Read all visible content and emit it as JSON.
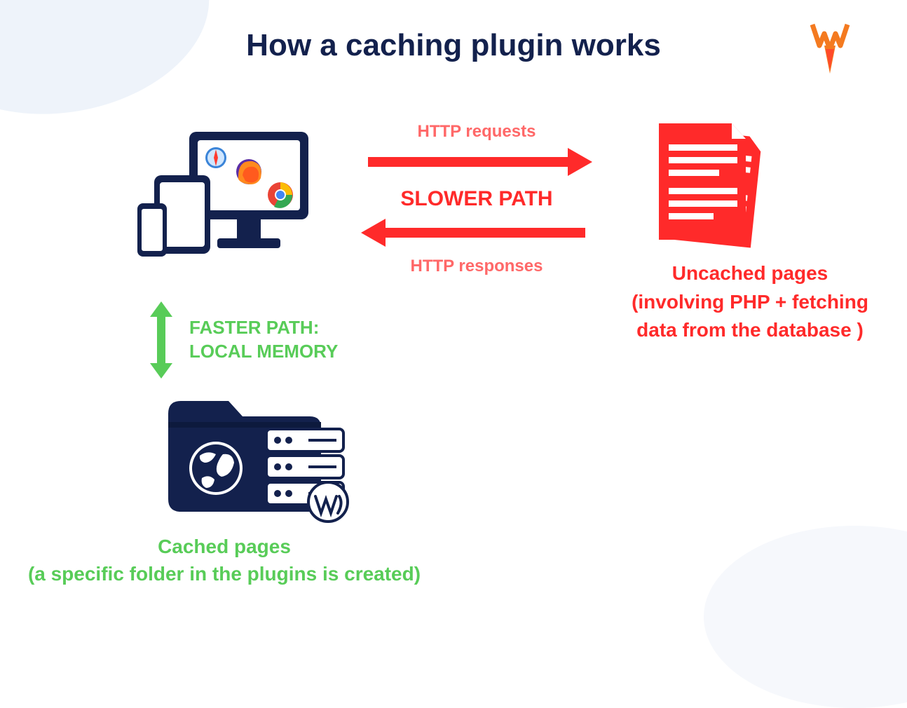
{
  "title": "How a caching plugin works",
  "arrows": {
    "top_label": "HTTP requests",
    "center_label": "SLOWER PATH",
    "bottom_label": "HTTP responses"
  },
  "uncached": {
    "line1": "Uncached pages",
    "line2": "(involving PHP + fetching",
    "line3": "data from the database )"
  },
  "faster": {
    "line1": "FASTER PATH:",
    "line2": "LOCAL MEMORY"
  },
  "cached": {
    "line1": "Cached pages",
    "line2": "(a specific folder in the plugins is created)"
  },
  "colors": {
    "navy": "#13214d",
    "red": "#ff2a2a",
    "salmon": "#ff6868",
    "green": "#58cc58",
    "orange": "#f47a20"
  }
}
